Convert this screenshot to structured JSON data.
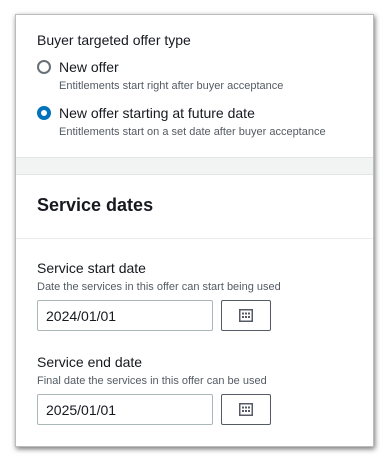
{
  "offer_type": {
    "label": "Buyer targeted offer type",
    "options": [
      {
        "title": "New offer",
        "description": "Entitlements start right after buyer acceptance",
        "selected": false
      },
      {
        "title": "New offer starting at future date",
        "description": "Entitlements start on a set date after buyer acceptance",
        "selected": true
      }
    ]
  },
  "service_dates": {
    "title": "Service dates",
    "start": {
      "label": "Service start date",
      "description": "Date the services in this offer can start being used",
      "value": "2024/01/01",
      "calendar_icon": "calendar-icon"
    },
    "end": {
      "label": "Service end date",
      "description": "Final date the services in this offer can be used",
      "value": "2025/01/01",
      "calendar_icon": "calendar-icon"
    }
  },
  "colors": {
    "accent": "#0073bb",
    "text": "#16191f",
    "secondary_text": "#545b64"
  }
}
